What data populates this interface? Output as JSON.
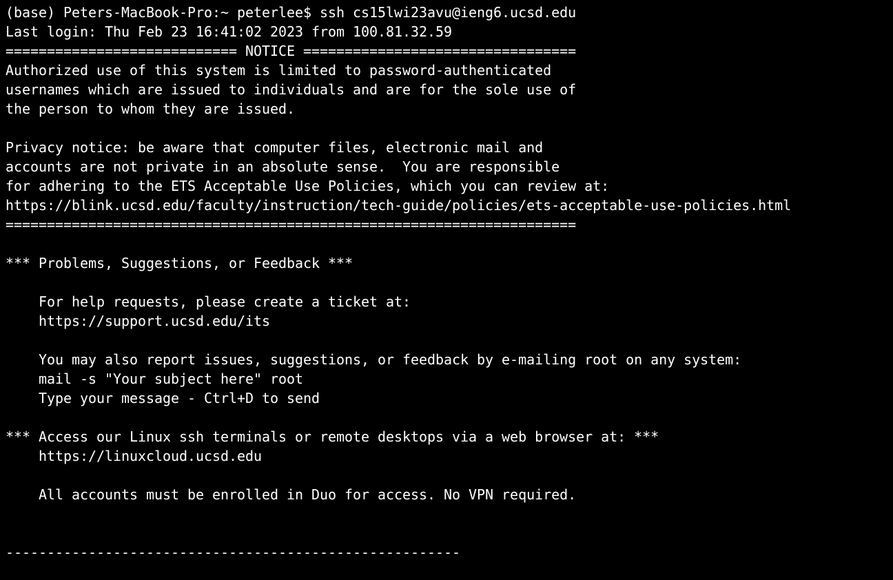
{
  "terminal": {
    "background": "#000000",
    "foreground": "#ffffff",
    "lines": [
      "(base) Peters-MacBook-Pro:~ peterlee$ ssh cs15lwi23avu@ieng6.ucsd.edu",
      "Last login: Thu Feb 23 16:41:02 2023 from 100.81.32.59",
      "============================ NOTICE =================================",
      "Authorized use of this system is limited to password-authenticated",
      "usernames which are issued to individuals and are for the sole use of",
      "the person to whom they are issued.",
      "",
      "Privacy notice: be aware that computer files, electronic mail and",
      "accounts are not private in an absolute sense.  You are responsible",
      "for adhering to the ETS Acceptable Use Policies, which you can review at:",
      "https://blink.ucsd.edu/faculty/instruction/tech-guide/policies/ets-acceptable-use-policies.html",
      "=====================================================================",
      "",
      "*** Problems, Suggestions, or Feedback ***",
      "",
      "    For help requests, please create a ticket at:",
      "    https://support.ucsd.edu/its",
      "",
      "    You may also report issues, suggestions, or feedback by e-mailing root on any system:",
      "    mail -s \"Your subject here\" root",
      "    Type your message - Ctrl+D to send",
      "",
      "*** Access our Linux ssh terminals or remote desktops via a web browser at: ***",
      "    https://linuxcloud.ucsd.edu",
      "",
      "    All accounts must be enrolled in Duo for access. No VPN required.",
      "",
      "",
      "-------------------------------------------------------"
    ]
  }
}
